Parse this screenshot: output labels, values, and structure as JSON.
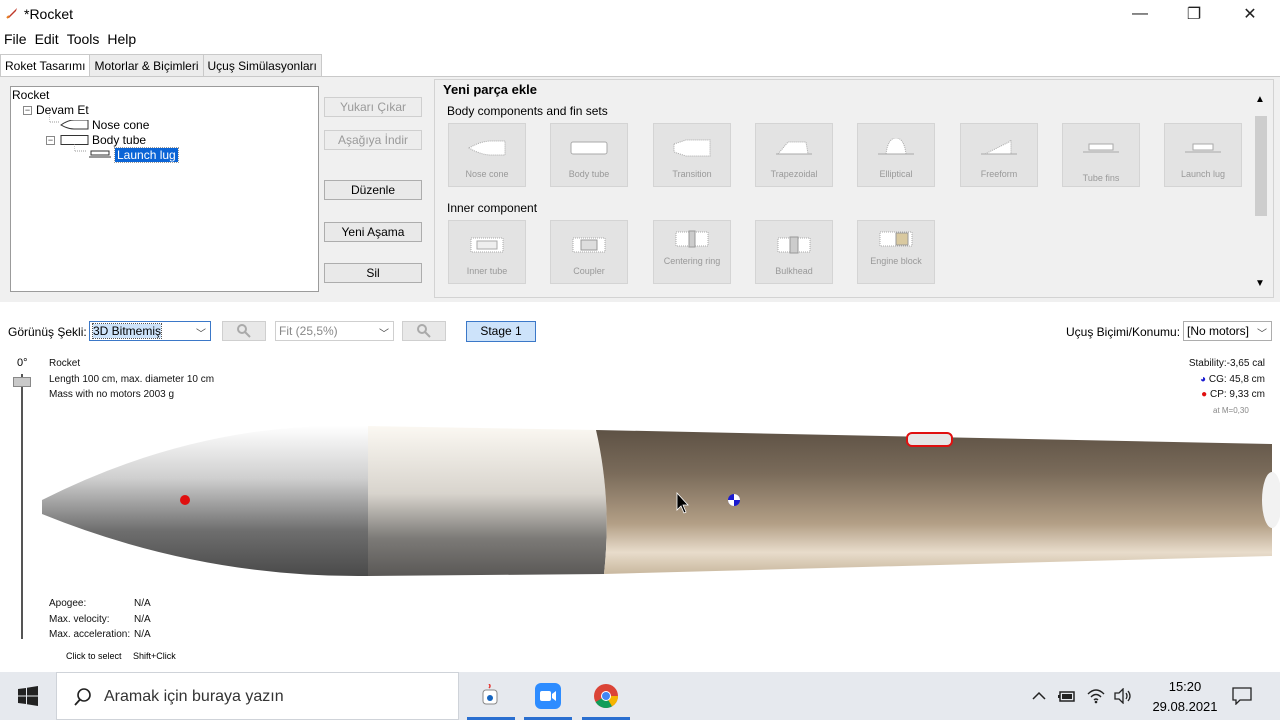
{
  "window": {
    "title": "*Rocket",
    "controls": {
      "minimize": "—",
      "maximize": "❐",
      "close": "✕"
    }
  },
  "menu": [
    "File",
    "Edit",
    "Tools",
    "Help"
  ],
  "tabs": [
    "Roket Tasarımı",
    "Motorlar & Biçimleri",
    "Uçuş Simülasyonları"
  ],
  "tree": {
    "root": "Rocket",
    "stage": "Devam Et",
    "nose": "Nose cone",
    "body": "Body tube",
    "lug": "Launch lug"
  },
  "buttons": {
    "up": "Yukarı Çıkar",
    "down": "Aşağıya İndir",
    "edit": "Düzenle",
    "new_stage": "Yeni Aşama",
    "delete": "Sil"
  },
  "add_parts": {
    "title": "Yeni parça ekle",
    "body_section": "Body components and fin sets",
    "body_parts": [
      "Nose cone",
      "Body tube",
      "Transition",
      "Trapezoidal",
      "Elliptical",
      "Freeform",
      "Tube fins",
      "Launch lug"
    ],
    "inner_section": "Inner component",
    "inner_parts": [
      "Inner tube",
      "Coupler",
      "Centering ring",
      "Bulkhead",
      "Engine block"
    ]
  },
  "toolbar": {
    "view_label": "Görünüş Şekli:",
    "view_value": "3D Bitmemiş",
    "zoom_value": "Fit (25,5%)",
    "stage": "Stage 1",
    "flight_label": "Uçuş Biçimi/Konumu:",
    "flight_value": "[No motors]"
  },
  "view": {
    "angle": "0°",
    "name": "Rocket",
    "length_info": "Length 100 cm, max. diameter 10 cm",
    "mass_info": "Mass with no motors 2003 g",
    "stability": "Stability:-3,65 cal",
    "cg": "CG: 45,8 cm",
    "cp": "CP: 9,33 cm",
    "mach": "at M=0,30",
    "apogee_label": "Apogee:",
    "apogee": "N/A",
    "velocity_label": "Max. velocity:",
    "velocity": "N/A",
    "accel_label": "Max. acceleration:",
    "accel": "N/A",
    "hint1": "Click to select",
    "hint2": "Shift+Click"
  },
  "taskbar": {
    "search_placeholder": "Aramak için buraya yazın",
    "time": "15:20",
    "date": "29.08.2021"
  },
  "colors": {
    "selection": "#0a64d6",
    "cp_marker": "#e01010",
    "cg_marker": "#1a1ad0",
    "body_tube": "#8a7a66"
  }
}
